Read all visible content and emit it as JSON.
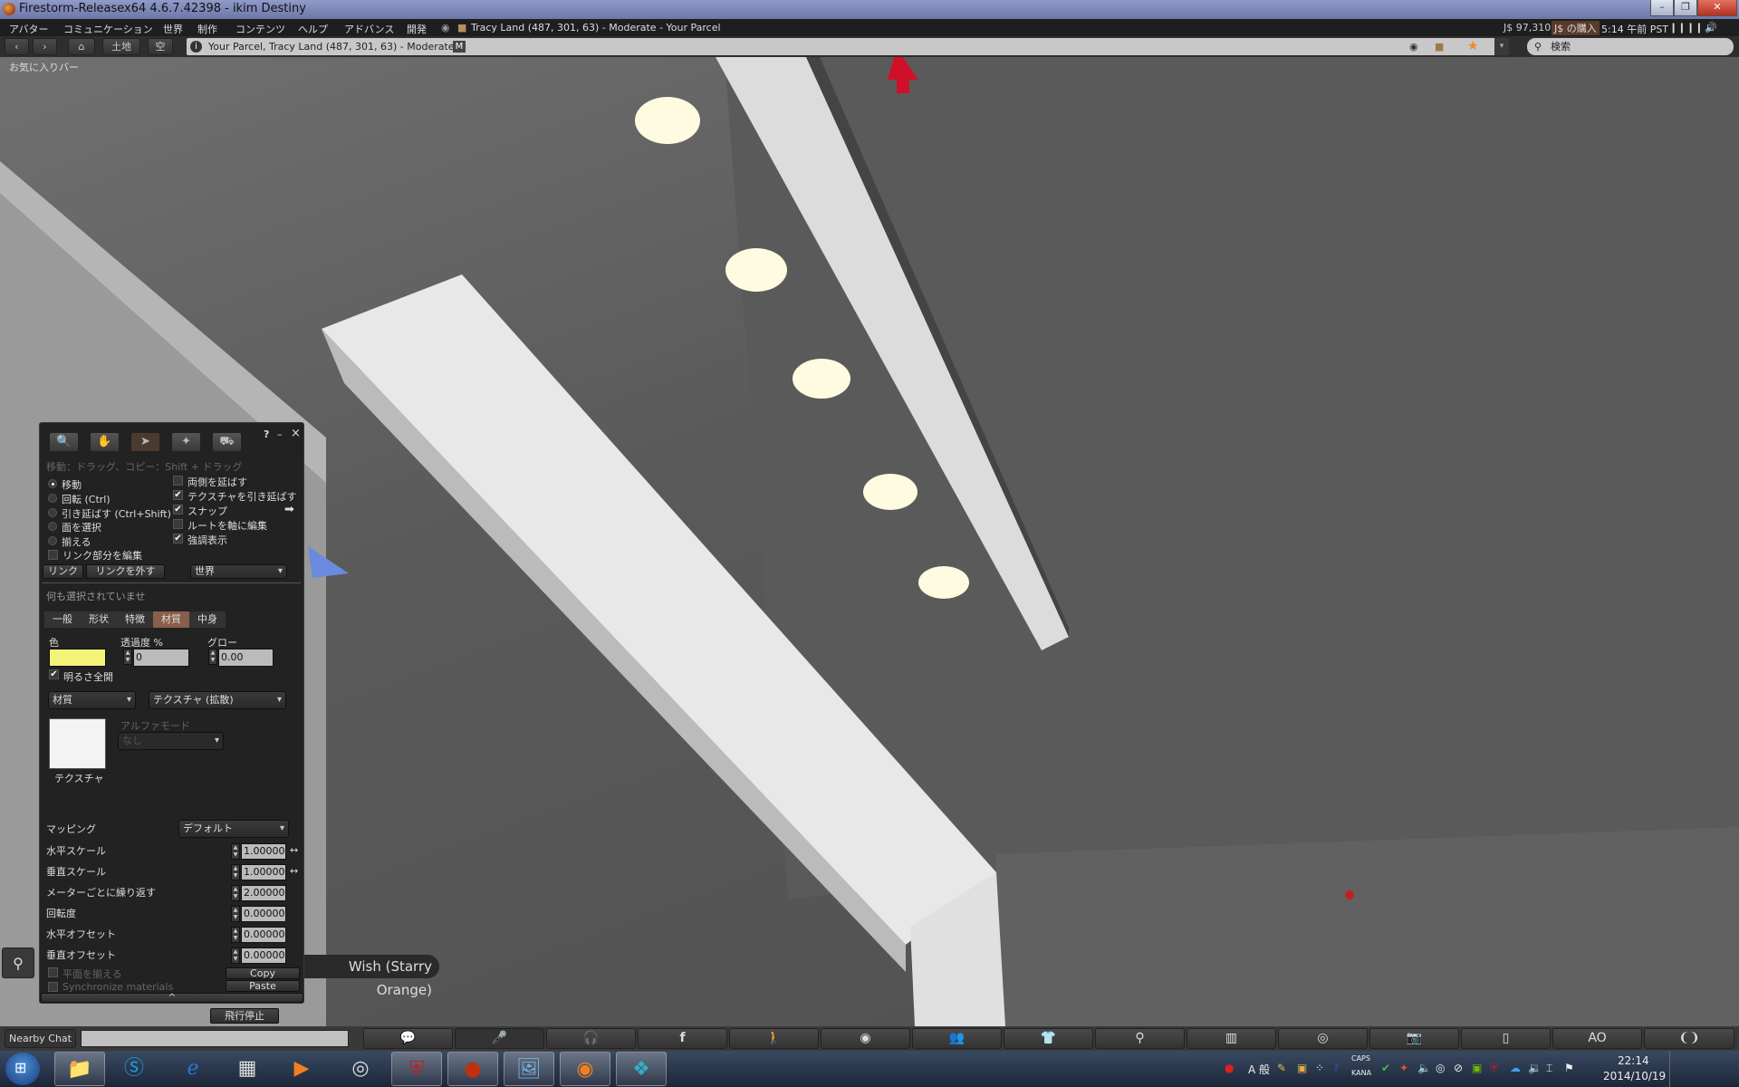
{
  "window": {
    "title": "Firestorm-Releasex64 4.6.7.42398 - ikim Destiny",
    "controls": [
      "minimize",
      "restore",
      "close"
    ]
  },
  "menubar": {
    "items": [
      "アバター",
      "コミュニケーション",
      "世界",
      "制作",
      "コンテンツ",
      "ヘルプ",
      "アドバンス",
      "開発"
    ],
    "parcel_info": "Tracy Land (487, 301, 63) - Moderate - Your Parcel",
    "balance": "J$ 97,310",
    "buy_currency": "J$ の購入",
    "time": "5:14 午前 PST"
  },
  "navbar": {
    "land_button": "土地",
    "sky_button": "空",
    "location": "Your Parcel, Tracy Land (487, 301, 63) - Moderate",
    "maturity_badge": "M",
    "search_placeholder": "検索"
  },
  "favorites_bar": "お気に入りバー",
  "build_floater": {
    "help": "?",
    "minimize": "–",
    "close": "×",
    "hint": "移動：ドラッグ、コピー：Shift + ドラッグ",
    "modes": [
      {
        "label": "移動",
        "selected": true
      },
      {
        "label": "回転 (Ctrl)",
        "selected": false
      },
      {
        "label": "引き延ばす (Ctrl+Shift)",
        "selected": false
      },
      {
        "label": "面を選択",
        "selected": false
      },
      {
        "label": "揃える",
        "selected": false
      }
    ],
    "edit_linked": {
      "label": "リンク部分を編集",
      "checked": false
    },
    "options": [
      {
        "label": "両側を延ばす",
        "checked": false
      },
      {
        "label": "テクスチャを引き延ばす",
        "checked": true
      },
      {
        "label": "スナップ",
        "checked": true
      },
      {
        "label": "ルートを軸に編集",
        "checked": false
      },
      {
        "label": "強調表示",
        "checked": true
      }
    ],
    "link_button": "リンク",
    "unlink_button": "リンクを外す",
    "ruler": "世界",
    "selection_status": "何も選択されていませ",
    "tabs": [
      "一般",
      "形状",
      "特徴",
      "材質",
      "中身"
    ],
    "active_tab": "材質",
    "color_label": "色",
    "color_value": "#f5f27a",
    "transparency_label": "透過度 %",
    "transparency_value": "0",
    "glow_label": "グロー",
    "glow_value": "0.00",
    "full_bright": {
      "label": "明るさ全開",
      "checked": true
    },
    "material_dropdown": "材質",
    "texture_type_dropdown": "テクスチャ (拡散)",
    "alpha_mode_label": "アルファモード",
    "alpha_mode_value": "なし",
    "texture_label": "テクスチャ",
    "mapping_label": "マッピング",
    "mapping_value": "デフォルト",
    "params": [
      {
        "label": "水平スケール",
        "value": "1.00000"
      },
      {
        "label": "垂直スケール",
        "value": "1.00000"
      },
      {
        "label": "メーターごとに繰り返す",
        "value": "2.00000"
      },
      {
        "label": "回転度",
        "value": "0.00000"
      },
      {
        "label": "水平オフセット",
        "value": "0.00000"
      },
      {
        "label": "垂直オフセット",
        "value": "0.00000"
      }
    ],
    "align_planar": {
      "label": "平面を揃える",
      "checked": false
    },
    "sync_materials": {
      "label": "Synchronize materials",
      "checked": false
    },
    "copy_button": "Copy",
    "paste_button": "Paste"
  },
  "stop_flying_button": "飛行停止",
  "now_playing": "Now playing: DJ Genki feat. ... Wish (Starry Orange)",
  "now_playing_visible": "Wish (Starry Orange)",
  "bottom_bar": {
    "nearby_chat": "Nearby Chat",
    "chat_value": "",
    "buttons": [
      "chat-icon",
      "microphone-icon",
      "headphones-icon",
      "facebook-icon",
      "walk-icon",
      "eye-icon",
      "people-icon",
      "shirt-icon",
      "search-icon",
      "map-icon",
      "radar-icon",
      "camera-icon",
      "inventory-icon",
      "AO",
      "avatar-icon"
    ],
    "ao_label": "AO"
  },
  "taskbar": {
    "apps": [
      "start",
      "explorer",
      "skype",
      "ie",
      "apps",
      "media-player",
      "chrome",
      "mcafee",
      "firestorm",
      "photos",
      "blender",
      "camera-app"
    ],
    "tray_caps": "CAPS",
    "tray_kana": "KANA",
    "ime": "A 般",
    "clock_time": "22:14",
    "clock_date": "2014/10/19"
  }
}
